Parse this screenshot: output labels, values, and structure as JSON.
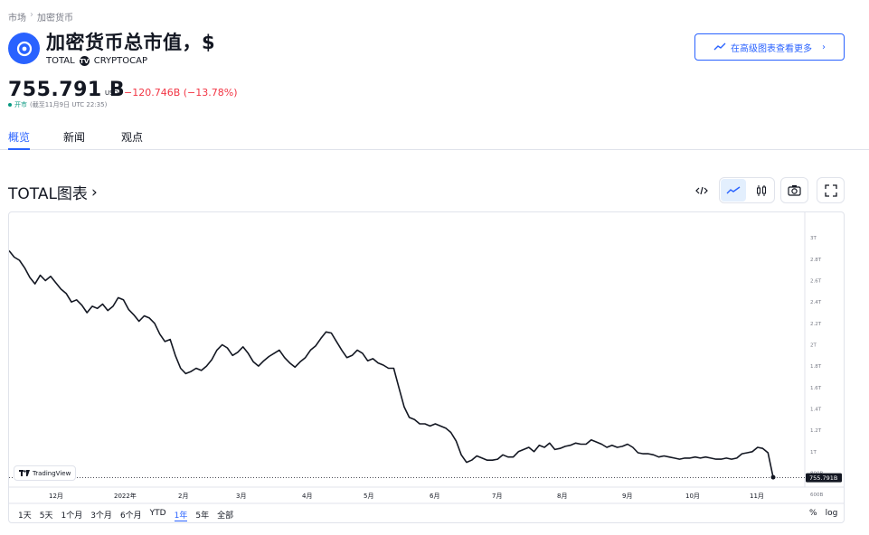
{
  "breadcrumb": [
    "市场",
    "加密货币"
  ],
  "header": {
    "title": "加密货币总市值，$",
    "symbol": "TOTAL",
    "exchange": "CRYPTOCAP",
    "advanced_button": "在高级图表查看更多"
  },
  "quote": {
    "price": "755.791 B",
    "unit": "USD",
    "change": "−120.746B",
    "change_pct": "(−13.78%)",
    "status": "开市",
    "as_of": "(截至11月9日 UTC 22:35)"
  },
  "tabs": [
    "概览",
    "新闻",
    "观点"
  ],
  "chart_section": {
    "heading": "TOTAL图表",
    "branding": "TradingView",
    "price_label": "755.791B"
  },
  "range_buttons": [
    "1天",
    "5天",
    "1个月",
    "3个月",
    "6个月",
    "YTD",
    "1年",
    "5年",
    "全部"
  ],
  "active_range": "1年",
  "scale_options": [
    "%",
    "log"
  ],
  "colors": {
    "accent": "#2962ff",
    "negative": "#f23645",
    "positive": "#089981",
    "line": "#131722"
  },
  "icons": [
    "crypto-logo-icon",
    "chevron-right-icon",
    "trend-icon",
    "embed-code-icon",
    "line-chart-icon",
    "candlestick-icon",
    "camera-icon",
    "fullscreen-icon",
    "tradingview-logo-icon"
  ],
  "chart_data": {
    "type": "line",
    "series": [
      {
        "values": [
          2.88,
          2.82,
          2.79,
          2.72,
          2.63,
          2.57,
          2.65,
          2.6,
          2.64,
          2.58,
          2.52,
          2.48,
          2.4,
          2.42,
          2.37,
          2.3,
          2.36,
          2.34,
          2.38,
          2.32,
          2.36,
          2.44,
          2.42,
          2.33,
          2.28,
          2.22,
          2.27,
          2.25,
          2.2,
          2.1,
          2.03,
          2.05,
          1.9,
          1.78,
          1.73,
          1.75,
          1.78,
          1.76,
          1.8,
          1.86,
          1.95,
          2.0,
          1.97,
          1.9,
          1.93,
          1.98,
          1.92,
          1.84,
          1.8,
          1.85,
          1.89,
          1.92,
          1.95,
          1.88,
          1.83,
          1.79,
          1.84,
          1.88,
          1.95,
          1.99,
          2.06,
          2.12,
          2.11,
          2.03,
          1.95,
          1.88,
          1.9,
          1.95,
          1.92,
          1.85,
          1.87,
          1.83,
          1.81,
          1.78,
          1.78,
          1.6,
          1.42,
          1.32,
          1.3,
          1.26,
          1.26,
          1.24,
          1.26,
          1.24,
          1.22,
          1.18,
          1.1,
          0.97,
          0.9,
          0.92,
          0.96,
          0.94,
          0.92,
          0.92,
          0.93,
          0.97,
          0.95,
          0.95,
          1.0,
          1.02,
          1.04,
          1.0,
          1.06,
          1.04,
          1.08,
          1.02,
          1.03,
          1.05,
          1.06,
          1.08,
          1.07,
          1.07,
          1.11,
          1.09,
          1.07,
          1.04,
          1.06,
          1.04,
          1.05,
          1.07,
          1.04,
          0.99,
          0.98,
          0.98,
          0.97,
          0.95,
          0.96,
          0.95,
          0.94,
          0.93,
          0.94,
          0.94,
          0.95,
          0.94,
          0.95,
          0.94,
          0.93,
          0.93,
          0.94,
          0.93,
          0.94,
          0.98,
          0.99,
          1.0,
          1.04,
          1.03,
          0.99,
          0.76
        ],
        "x_start": "2021-11-09",
        "x_end": "2022-11-09"
      }
    ],
    "x_ticks": [
      "12月",
      "2022年",
      "2月",
      "3月",
      "4月",
      "5月",
      "6月",
      "7月",
      "8月",
      "9月",
      "10月",
      "11月"
    ],
    "y_ticks": [
      "3T",
      "2.8T",
      "2.6T",
      "2.4T",
      "2.2T",
      "2T",
      "1.8T",
      "1.6T",
      "1.4T",
      "1.2T",
      "1T",
      "800B",
      "600B"
    ],
    "y_tick_values": [
      3.0,
      2.8,
      2.6,
      2.4,
      2.2,
      2.0,
      1.8,
      1.6,
      1.4,
      1.2,
      1.0,
      0.8,
      0.6
    ],
    "ylim": [
      0.55,
      3.12
    ],
    "ylabel": "",
    "xlabel": "",
    "last_value": 0.755791,
    "grid": false
  }
}
